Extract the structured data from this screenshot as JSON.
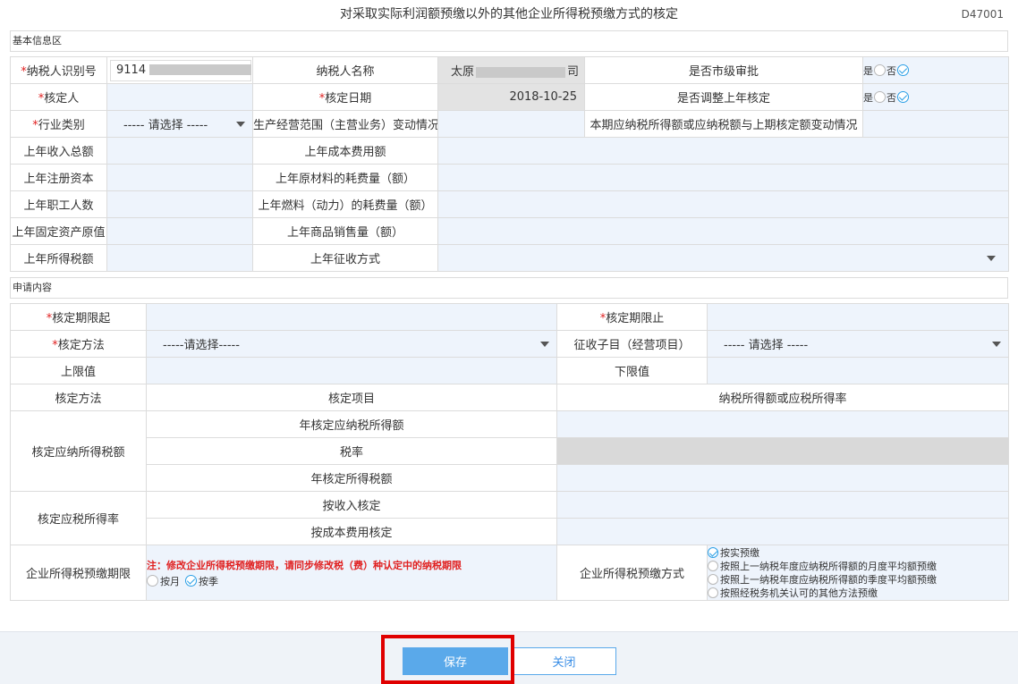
{
  "page": {
    "title": "对采取实际利润额预缴以外的其他企业所得税预缴方式的核定",
    "code": "D47001"
  },
  "section_basic": "基本信息区",
  "section_apply": "申请内容",
  "basic": {
    "taxpayer_id_label": "纳税人识别号",
    "taxpayer_id_value": "9114",
    "taxpayer_name_label": "纳税人名称",
    "taxpayer_name_prefix": "太原",
    "taxpayer_name_suffix": "司",
    "city_review_label": "是否市级审批",
    "yes": "是",
    "no": "否",
    "verifier_label": "核定人",
    "verify_date_label": "核定日期",
    "verify_date_value": "2018-10-25",
    "adjust_last_year_label": "是否调整上年核定",
    "industry_label": "行业类别",
    "industry_placeholder": "----- 请选择 -----",
    "scope_change_label": "生产经营范围（主营业务）变动情况",
    "income_change_label": "本期应纳税所得额或应纳税额与上期核定额变动情况",
    "last_income_label": "上年收入总额",
    "last_cost_label": "上年成本费用额",
    "last_capital_label": "上年注册资本",
    "last_material_label": "上年原材料的耗费量（额）",
    "last_staff_label": "上年职工人数",
    "last_fuel_label": "上年燃料（动力）的耗费量（额）",
    "last_assets_label": "上年固定资产原值",
    "last_sales_label": "上年商品销售量（额）",
    "last_tax_label": "上年所得税额",
    "last_collection_label": "上年征收方式"
  },
  "apply": {
    "period_start_label": "核定期限起",
    "period_end_label": "核定期限止",
    "method_label": "核定方法",
    "method_placeholder": "-----请选择-----",
    "item_label": "征收子目（经营项目）",
    "item_placeholder": "----- 请选择 -----",
    "upper_label": "上限值",
    "lower_label": "下限值",
    "col_method": "核定方法",
    "col_item": "核定项目",
    "col_rate": "纳税所得额或应税所得率",
    "group1_label": "核定应纳所得税额",
    "g1_r1": "年核定应纳税所得额",
    "g1_r2": "税率",
    "g1_r3": "年核定所得税额",
    "group2_label": "核定应税所得率",
    "g2_r1": "按收入核定",
    "g2_r2": "按成本费用核定",
    "prepay_period_label": "企业所得税预缴期限",
    "prepay_note": "注：修改企业所得税预缴期限，请同步修改税（费）种认定中的纳税期限",
    "monthly": "按月",
    "quarterly": "按季",
    "prepay_method_label": "企业所得税预缴方式",
    "methods": [
      "按实预缴",
      "按照上一纳税年度应纳税所得额的月度平均额预缴",
      "按照上一纳税年度应纳税所得额的季度平均额预缴",
      "按照经税务机关认可的其他方法预缴"
    ]
  },
  "footer": {
    "save": "保存",
    "close": "关闭"
  },
  "colors": {
    "input_bg": "#eef4fc",
    "required": "#e02020",
    "primary": "#5aa9ea",
    "highlight": "#e00000"
  }
}
